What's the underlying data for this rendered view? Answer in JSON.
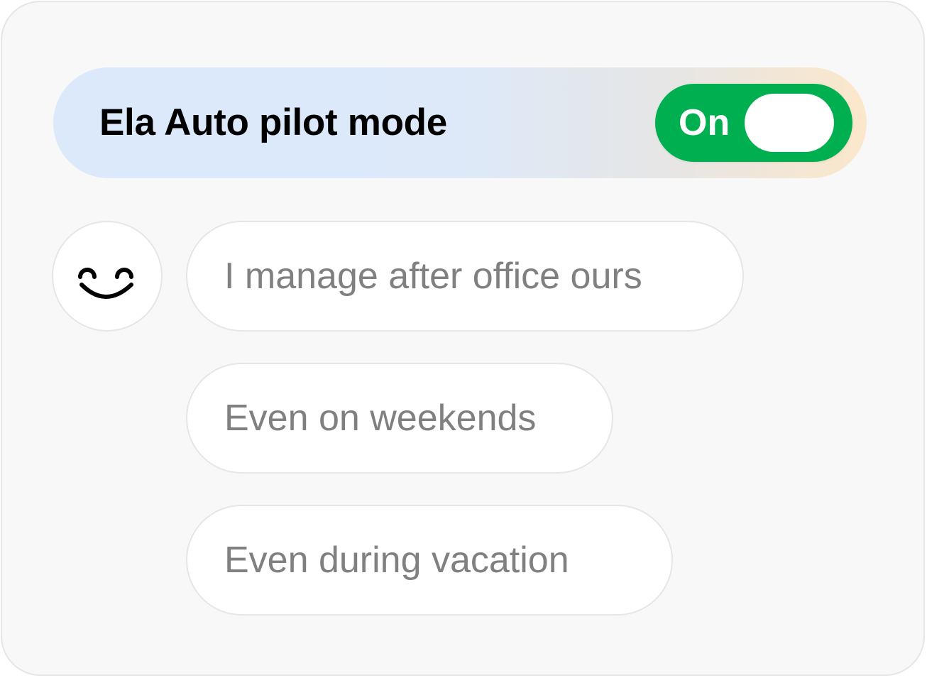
{
  "autopilot": {
    "title": "Ela Auto pilot mode",
    "toggle_state_label": "On",
    "toggle_on": true
  },
  "assistant": {
    "avatar_icon": "smiling-face-icon"
  },
  "messages": [
    {
      "text": "I manage after office ours"
    },
    {
      "text": "Even on weekends"
    },
    {
      "text": "Even during vacation"
    }
  ],
  "colors": {
    "toggle_on": "#00b050",
    "banner_start": "#dbe9fb",
    "banner_end": "#fbe7cb",
    "message_text": "#808080",
    "background": "#f8f8f8"
  }
}
